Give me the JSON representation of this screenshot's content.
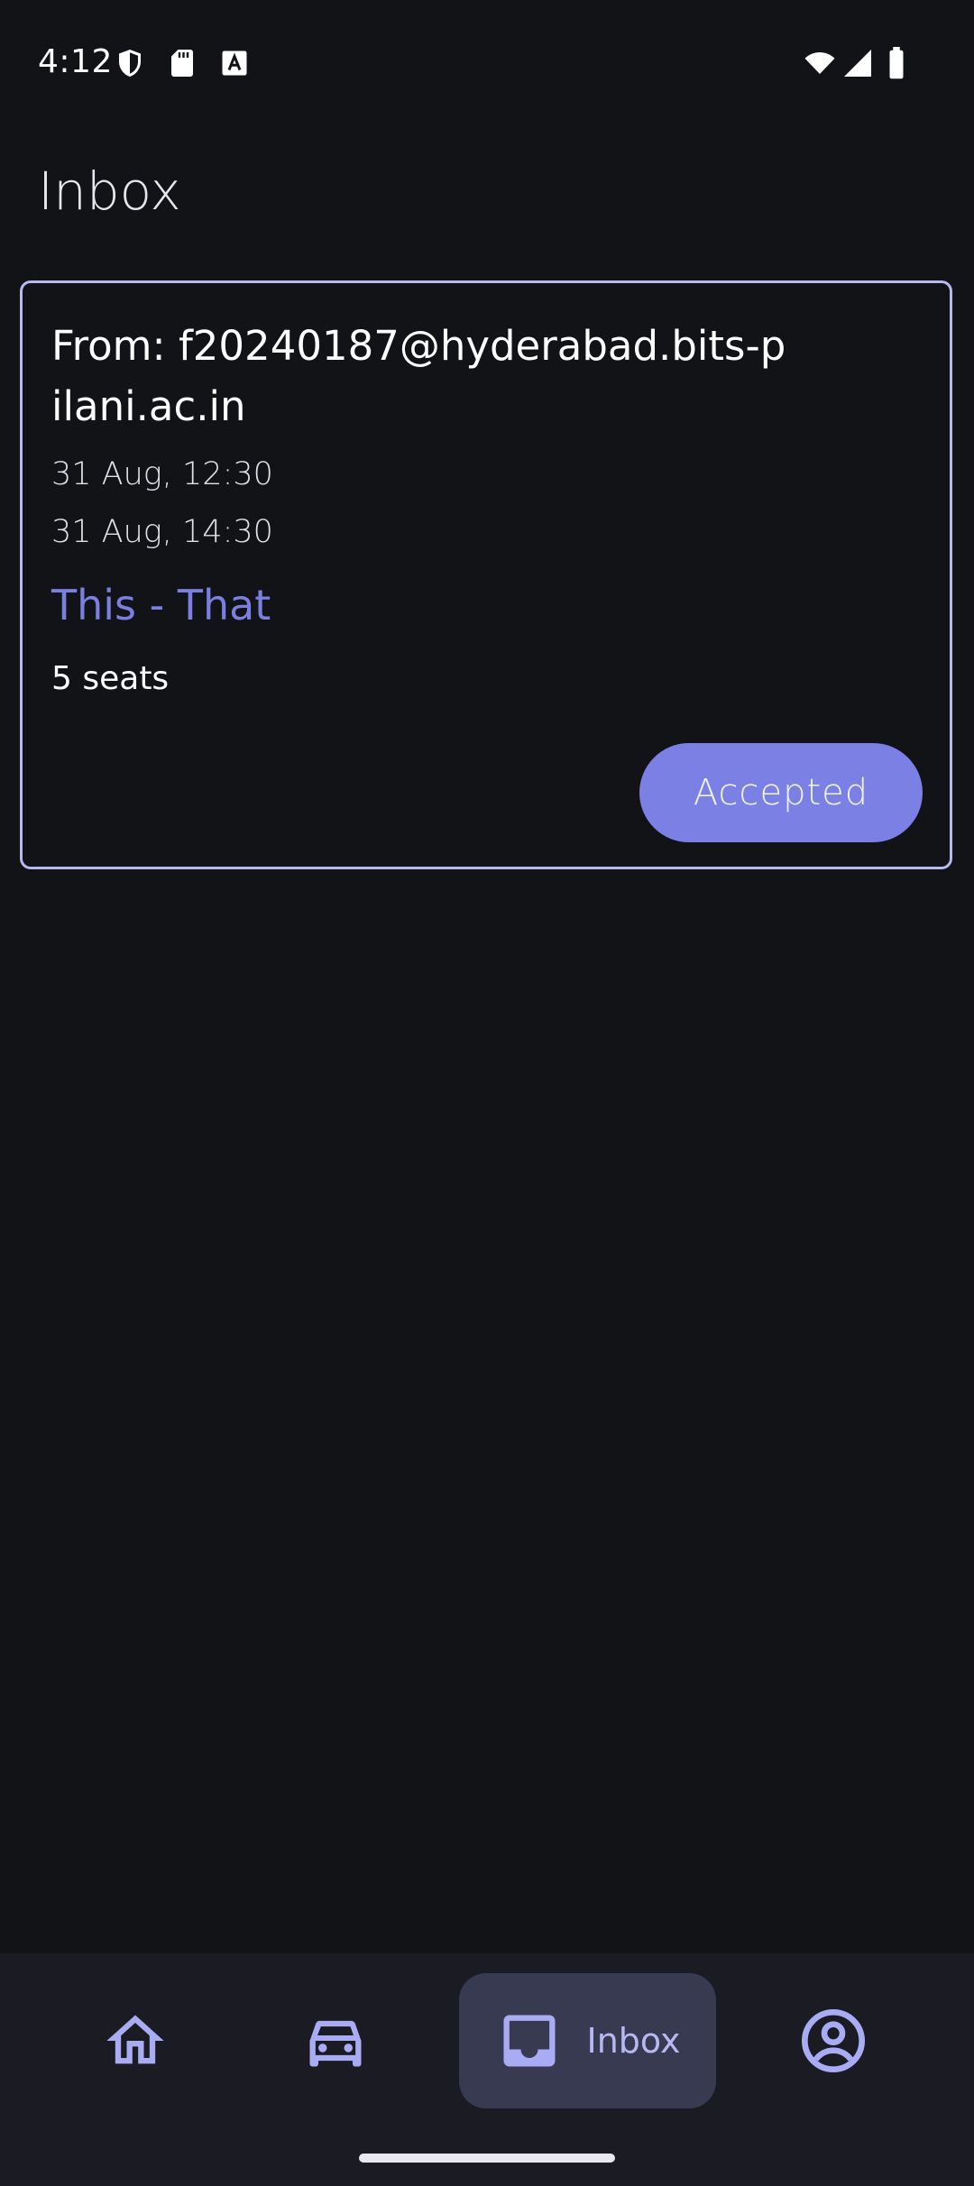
{
  "status_bar": {
    "time": "4:12",
    "left_icons": [
      "shield-icon",
      "sd-card-icon",
      "font-a-icon"
    ],
    "right_icons": [
      "wifi-icon",
      "signal-icon",
      "battery-icon"
    ]
  },
  "header": {
    "title": "Inbox"
  },
  "card": {
    "from": "From: f20240187@hyderabad.bits-pilani.ac.in",
    "date_start": "31 Aug, 12:30",
    "date_end": "31 Aug, 14:30",
    "route": "This - That",
    "seats": "5 seats",
    "status_label": "Accepted"
  },
  "nav": {
    "items": [
      {
        "icon": "home-icon",
        "label": ""
      },
      {
        "icon": "car-icon",
        "label": ""
      },
      {
        "icon": "inbox-icon",
        "label": "Inbox",
        "active": true
      },
      {
        "icon": "account-icon",
        "label": ""
      }
    ]
  },
  "colors": {
    "background": "#121317",
    "card_border": "#b7b9f1",
    "accent": "#7b80e4",
    "nav_background": "#1b1c23",
    "nav_active": "#383a52",
    "nav_icon": "#a9acf3"
  }
}
